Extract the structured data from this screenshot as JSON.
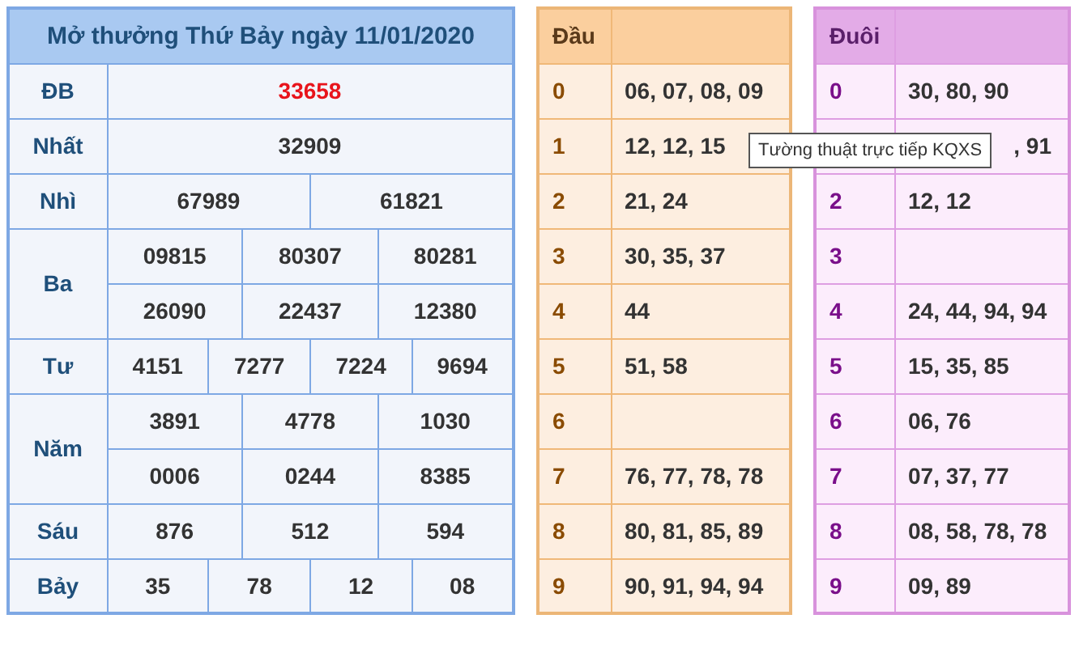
{
  "results": {
    "title": "Mở thưởng Thứ Bảy ngày 11/01/2020",
    "prizes": [
      {
        "name": "ĐB",
        "highlight": true,
        "rows": [
          [
            "33658"
          ]
        ]
      },
      {
        "name": "Nhất",
        "highlight": false,
        "rows": [
          [
            "32909"
          ]
        ]
      },
      {
        "name": "Nhì",
        "highlight": false,
        "rows": [
          [
            "67989",
            "61821"
          ]
        ]
      },
      {
        "name": "Ba",
        "highlight": false,
        "rows": [
          [
            "09815",
            "80307",
            "80281"
          ],
          [
            "26090",
            "22437",
            "12380"
          ]
        ]
      },
      {
        "name": "Tư",
        "highlight": false,
        "rows": [
          [
            "4151",
            "7277",
            "7224",
            "9694"
          ]
        ]
      },
      {
        "name": "Năm",
        "highlight": false,
        "rows": [
          [
            "3891",
            "4778",
            "1030"
          ],
          [
            "0006",
            "0244",
            "8385"
          ]
        ]
      },
      {
        "name": "Sáu",
        "highlight": false,
        "rows": [
          [
            "876",
            "512",
            "594"
          ]
        ]
      },
      {
        "name": "Bảy",
        "highlight": false,
        "rows": [
          [
            "35",
            "78",
            "12",
            "08"
          ]
        ]
      }
    ]
  },
  "head_table": {
    "header": "Đầu",
    "rows": [
      {
        "digit": "0",
        "value": "06, 07, 08, 09"
      },
      {
        "digit": "1",
        "value": "12, 12, 15"
      },
      {
        "digit": "2",
        "value": "21, 24"
      },
      {
        "digit": "3",
        "value": "30, 35, 37"
      },
      {
        "digit": "4",
        "value": "44"
      },
      {
        "digit": "5",
        "value": "51, 58"
      },
      {
        "digit": "6"
      },
      {
        "digit": "7",
        "value": "76, 77, 78, 78"
      },
      {
        "digit": "8",
        "value": "80, 81, 85, 89"
      },
      {
        "digit": "9",
        "value": "90, 91, 94, 94"
      }
    ]
  },
  "tail_table": {
    "header": "Đuôi",
    "rows": [
      {
        "digit": "0",
        "value": "30, 80, 90"
      },
      {
        "value": ", 91",
        "partial": true
      },
      {
        "digit": "2",
        "value": "12, 12"
      },
      {
        "digit": "3"
      },
      {
        "digit": "4",
        "value": "24, 44, 94, 94"
      },
      {
        "digit": "5",
        "value": "15, 35, 85"
      },
      {
        "digit": "6",
        "value": "06, 76"
      },
      {
        "digit": "7",
        "value": "07, 37, 77"
      },
      {
        "digit": "8",
        "value": "08, 58, 78, 78"
      },
      {
        "digit": "9",
        "value": "09, 89"
      }
    ]
  },
  "tooltip": {
    "text": "Tường thuật trực tiếp KQXS"
  }
}
